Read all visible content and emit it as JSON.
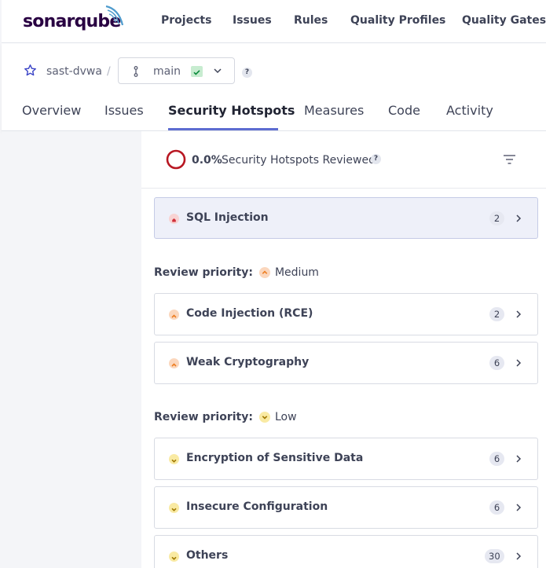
{
  "app": {
    "logo_text": "sonarqube"
  },
  "topnav": [
    "Projects",
    "Issues",
    "Rules",
    "Quality Profiles",
    "Quality Gates"
  ],
  "project": {
    "name": "sast-dvwa",
    "separator": "/",
    "branch": "main",
    "help": "?"
  },
  "tabs": [
    "Overview",
    "Issues",
    "Security Hotspots",
    "Measures",
    "Code",
    "Activity"
  ],
  "active_tab": "Security Hotspots",
  "summary": {
    "percent": "0.0%",
    "label": "Security Hotspots Reviewed",
    "help": "?"
  },
  "groups": {
    "high": {
      "items": [
        {
          "title": "SQL Injection",
          "count": "2"
        }
      ]
    },
    "medium": {
      "label": "Review priority:",
      "level": "Medium",
      "items": [
        {
          "title": "Code Injection (RCE)",
          "count": "2"
        },
        {
          "title": "Weak Cryptography",
          "count": "6"
        }
      ]
    },
    "low": {
      "label": "Review priority:",
      "level": "Low",
      "items": [
        {
          "title": "Encryption of Sensitive Data",
          "count": "6"
        },
        {
          "title": "Insecure Configuration",
          "count": "6"
        },
        {
          "title": "Others",
          "count": "30"
        }
      ]
    }
  },
  "colors": {
    "accent": "#5d6cd1",
    "priority_high": "#d02f3a",
    "priority_medium": "#ed7d20",
    "priority_low": "#c79b00",
    "ring": "#b81722"
  },
  "icons": {
    "logo": "sonarqube-arc-icon",
    "favorite": "star-icon",
    "branch": "branch-icon",
    "quality_gate": "check-icon",
    "dropdown": "chevron-down-icon",
    "filter": "filter-icon",
    "expand": "chevron-right-icon"
  }
}
